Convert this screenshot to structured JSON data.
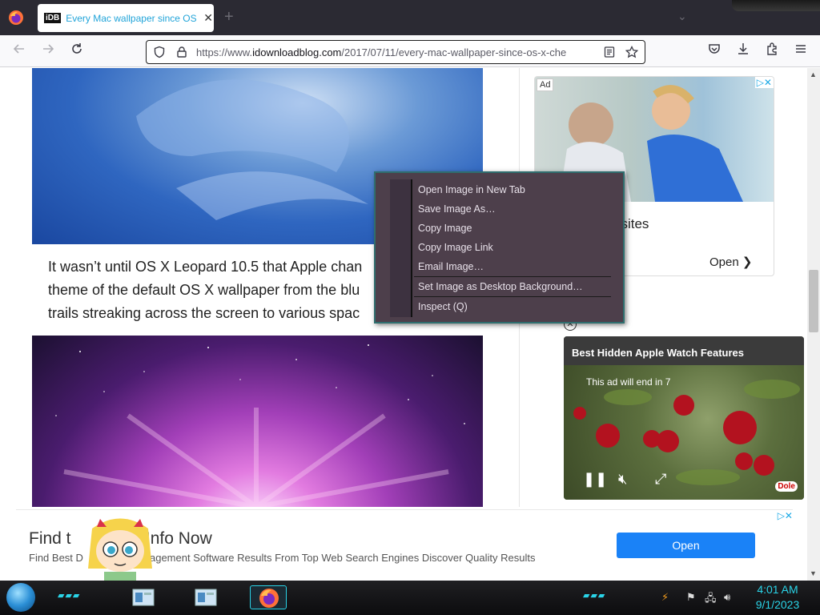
{
  "browser": {
    "tab": {
      "favicon_text": "iDB",
      "title": "Every Mac wallpaper since OS X",
      "close_glyph": "✕"
    },
    "new_tab_glyph": "+",
    "tab_list_glyph": "⌄",
    "url": {
      "prefix": "https://www.",
      "domain": "idownloadblog.com",
      "path": "/2017/07/11/every-mac-wallpaper-since-os-x-che"
    }
  },
  "article": {
    "lines": [
      "It wasn’t until OS X Leopard 10.5 that Apple chan",
      "theme of the default OS X wallpaper from the blu",
      "trails streaking across the screen to various spac"
    ]
  },
  "ad_top": {
    "label": "Ad",
    "headline": "bsites",
    "open_label": "Open",
    "open_glyph": "❯"
  },
  "video_ad": {
    "title": "Best Hidden Apple Watch Features",
    "countdown": "This ad will end in 7",
    "brand": "Dole",
    "close_glyph": "✕"
  },
  "bottom_ad": {
    "title": "Find t                Info Now",
    "description": "Find Best D                Management Software Results From Top Web Search Engines Discover Quality Results",
    "open_label": "Open"
  },
  "context_menu": {
    "items": [
      "Open Image in New Tab",
      "Save Image As…",
      "Copy Image",
      "Copy Image Link",
      "Email Image…",
      "Set Image as Desktop Background…",
      "Inspect (Q)"
    ]
  },
  "taskbar": {
    "time": "4:01 AM",
    "date": "9/1/2023",
    "deco_glyphs": "▰▰▰"
  },
  "colors": {
    "accent": "#2ad4e8",
    "menu_bg": "#4d3f4b",
    "open_button": "#1a82f7",
    "tab_title": "#21a4d9"
  },
  "icons": [
    "firefox-icon",
    "back-icon",
    "forward-icon",
    "reload-icon",
    "shield-icon",
    "lock-icon",
    "reader-view-icon",
    "bookmark-star-icon",
    "pocket-icon",
    "download-icon",
    "extensions-icon",
    "menu-icon",
    "start-orb-icon",
    "flag-icon",
    "network-icon",
    "volume-icon"
  ]
}
